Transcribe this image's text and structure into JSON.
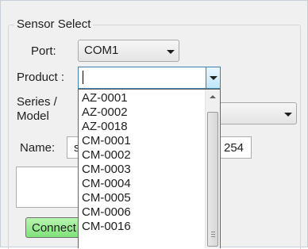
{
  "sensor_select": {
    "group_title": "Sensor Select",
    "port_label": "Port:",
    "port_value": "COM1",
    "product_label": "Product :",
    "product_value": "",
    "series_label_line1": "Series /",
    "series_label_line2": "Model",
    "name_label": "Name:",
    "name_value_partial": "s",
    "name_value_right": "254",
    "connect_label": "Connect"
  },
  "product_dropdown": {
    "options": [
      "AZ-0001",
      "AZ-0002",
      "AZ-0018",
      "CM-0001",
      "CM-0002",
      "CM-0003",
      "CM-0004",
      "CM-0005",
      "CM-0006",
      "CM-0016"
    ]
  },
  "colors": {
    "connect_green": "#7fe27a",
    "dropdown_button_blue": "#bee6fd"
  }
}
